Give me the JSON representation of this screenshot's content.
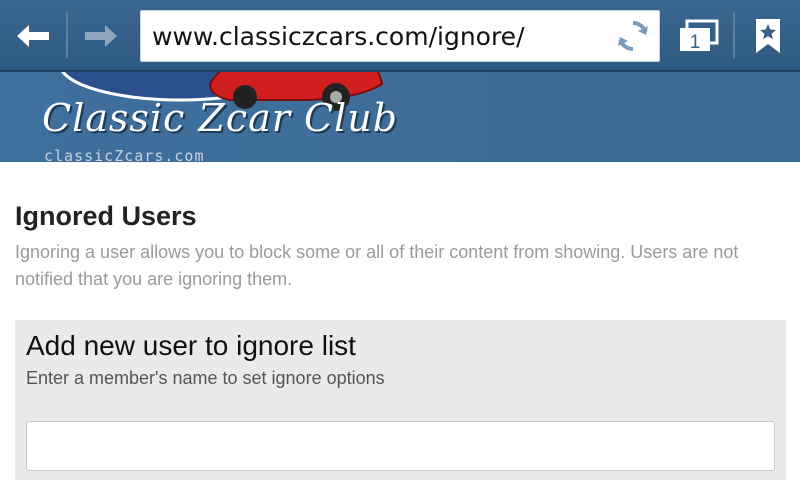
{
  "browser": {
    "url": "www.classiczcars.com/ignore/",
    "tab_count": "1"
  },
  "banner": {
    "title": "Classic Zcar Club",
    "subtitle": "classicZcars.com"
  },
  "page": {
    "title": "Ignored Users",
    "description": "Ignoring a user allows you to block some or all of their content from showing. Users are not notified that you are ignoring them."
  },
  "add_panel": {
    "title": "Add new user to ignore list",
    "subtitle": "Enter a member's name to set ignore options",
    "input_value": "",
    "input_placeholder": ""
  },
  "colors": {
    "toolbar": "#35618a",
    "banner": "#3f6f9c",
    "panel": "#eaeaea"
  }
}
